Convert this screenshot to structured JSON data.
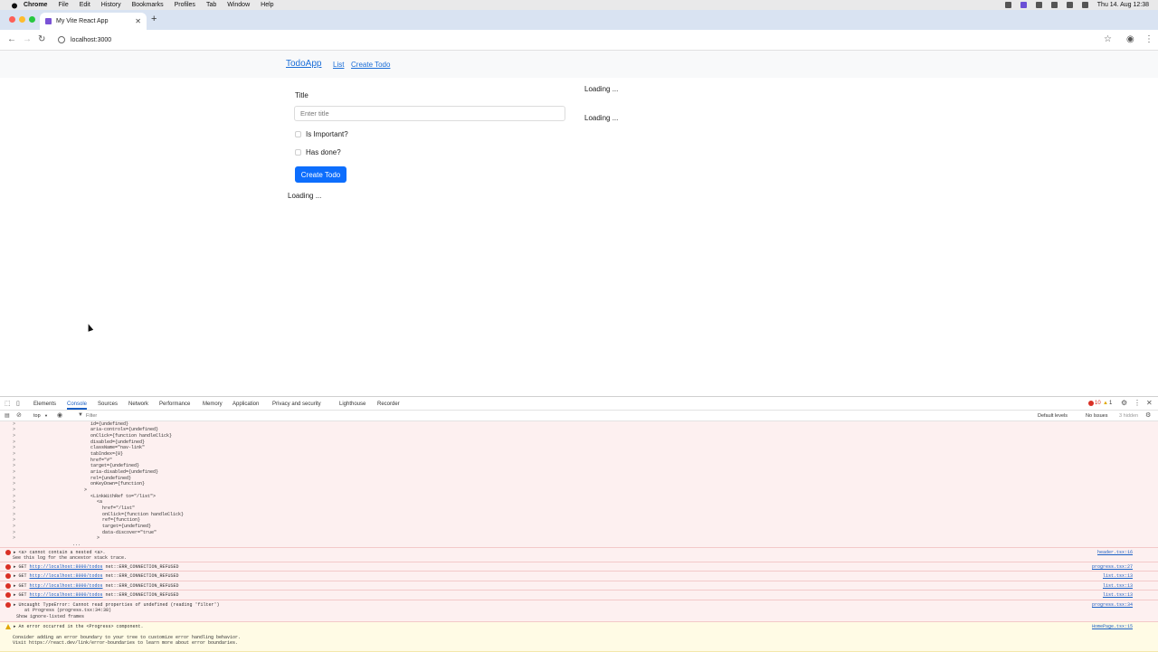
{
  "menubar": {
    "app": "Chrome",
    "items": [
      "File",
      "Edit",
      "History",
      "Bookmarks",
      "Profiles",
      "Tab",
      "Window",
      "Help"
    ],
    "datetime": "Thu 14. Aug  12:38"
  },
  "browser": {
    "tab_title": "My Vite React App",
    "url": "localhost:3000"
  },
  "page": {
    "brand": "TodoApp",
    "nav": {
      "list": "List",
      "create": "Create Todo"
    },
    "form": {
      "title_label": "Title",
      "title_placeholder": "Enter title",
      "important_label": "Is Important?",
      "done_label": "Has done?",
      "submit": "Create Todo"
    },
    "loading_text": "Loading ..."
  },
  "devtools": {
    "tabs": [
      "Elements",
      "Console",
      "Sources",
      "Network",
      "Performance",
      "Memory",
      "Application",
      "Privacy and security",
      "Lighthouse",
      "Recorder"
    ],
    "active_tab": "Console",
    "context": "top",
    "filter_placeholder": "Filter",
    "levels": "Default levels",
    "issues": "No Issues",
    "hidden": "3 hidden",
    "error_count": "10",
    "warn_count": "1",
    "stack_lines": [
      "id={undefined}",
      "aria-controls={undefined}",
      "onClick={function handleClick}",
      "disabled={undefined}",
      "className=\"nav-link\"",
      "tabIndex={0}",
      "href=\"#\"",
      "target={undefined}",
      "aria-disabled={undefined}",
      "rel={undefined}",
      "onKeyDown={function}",
      ">",
      "<LinkWithRef to=\"/list\">",
      "<a",
      "href=\"/list\"",
      "onClick={function handleClick}",
      "ref={function}",
      "target={undefined}",
      "data-discover=\"true\"",
      ">",
      "..."
    ],
    "messages": [
      {
        "type": "error",
        "text": "▸ <a> cannot contain a nested <a>.",
        "text2": "See this log for the ancestor stack trace.",
        "source": "header.tsx:16"
      },
      {
        "type": "error",
        "prefix": "▸ GET ",
        "url": "http://localhost:8000/todos",
        "suffix": " net::ERR_CONNECTION_REFUSED",
        "source": "progress.tsx:27"
      },
      {
        "type": "error",
        "prefix": "▸ GET ",
        "url": "http://localhost:8000/todos",
        "suffix": " net::ERR_CONNECTION_REFUSED",
        "source": "list.tsx:13"
      },
      {
        "type": "error",
        "prefix": "▸ GET ",
        "url": "http://localhost:8000/todos",
        "suffix": " net::ERR_CONNECTION_REFUSED",
        "source": "list.tsx:13"
      },
      {
        "type": "error",
        "prefix": "▸ GET ",
        "url": "http://localhost:8000/todos",
        "suffix": " net::ERR_CONNECTION_REFUSED",
        "source": "list.tsx:13"
      },
      {
        "type": "error",
        "text": "▸ Uncaught TypeError: Cannot read properties of undefined (reading 'filter')",
        "text2": "at Progress (progress.tsx:34:38)",
        "text3": "Show ignore-listed frames",
        "source": "progress.tsx:34"
      },
      {
        "type": "warn",
        "text": "▸ An error occurred in the <Progress> component.",
        "text2": "Consider adding an error boundary to your tree to customize error handling behavior.",
        "text3": "Visit https://react.dev/link/error-boundaries to learn more about error boundaries.",
        "source": "HomePage.tsx:15"
      }
    ]
  },
  "colors": {
    "primary": "#0d6efd",
    "link": "#1a6ed8",
    "error_bg": "#fdf0f0",
    "warn_bg": "#fffbe5"
  }
}
